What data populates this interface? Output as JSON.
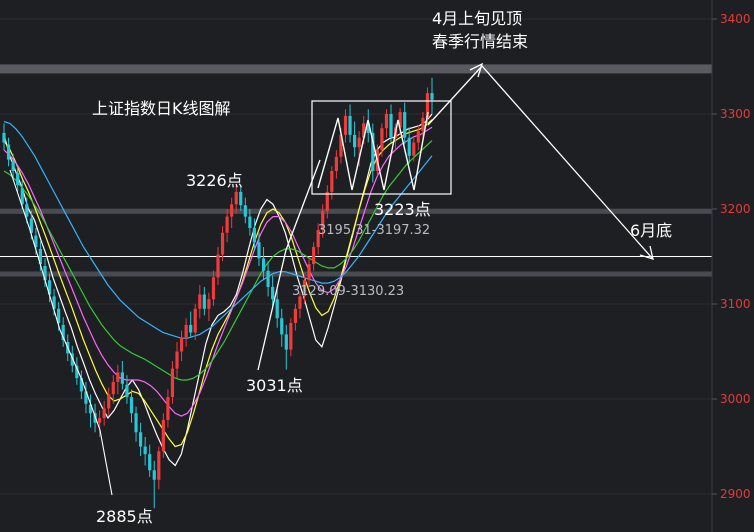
{
  "chart_data": {
    "type": "candlestick",
    "title": "上证指数日K线图解",
    "y_axis": {
      "ylim": [
        2860,
        3420
      ],
      "tick_values": [
        2900,
        3000,
        3100,
        3200,
        3300,
        3400
      ],
      "tick_labels": [
        "2900",
        "3000",
        "3100",
        "3200",
        "3300",
        "3400"
      ]
    },
    "candles_ohlc": [
      [
        3280,
        3290,
        3262,
        3270
      ],
      [
        3268,
        3275,
        3245,
        3252
      ],
      [
        3250,
        3258,
        3232,
        3240
      ],
      [
        3238,
        3245,
        3218,
        3225
      ],
      [
        3222,
        3230,
        3200,
        3205
      ],
      [
        3205,
        3212,
        3185,
        3192
      ],
      [
        3190,
        3198,
        3168,
        3175
      ],
      [
        3172,
        3180,
        3152,
        3160
      ],
      [
        3158,
        3166,
        3135,
        3142
      ],
      [
        3140,
        3148,
        3118,
        3125
      ],
      [
        3125,
        3132,
        3102,
        3110
      ],
      [
        3108,
        3116,
        3088,
        3095
      ],
      [
        3095,
        3102,
        3072,
        3080
      ],
      [
        3078,
        3086,
        3055,
        3062
      ],
      [
        3060,
        3068,
        3040,
        3048
      ],
      [
        3048,
        3056,
        3028,
        3035
      ],
      [
        3035,
        3044,
        3015,
        3022
      ],
      [
        3022,
        3030,
        3000,
        3008
      ],
      [
        3008,
        3018,
        2985,
        2995
      ],
      [
        2994,
        3005,
        2970,
        2985
      ],
      [
        2985,
        2995,
        2965,
        2975
      ],
      [
        2975,
        2988,
        2960,
        2980
      ],
      [
        2980,
        2998,
        2972,
        2990
      ],
      [
        2990,
        3012,
        2982,
        3005
      ],
      [
        3005,
        3025,
        2995,
        3018
      ],
      [
        3018,
        3036,
        3005,
        3028
      ],
      [
        3028,
        3040,
        3010,
        3016
      ],
      [
        3015,
        3025,
        2995,
        3002
      ],
      [
        3002,
        3010,
        2975,
        2985
      ],
      [
        2985,
        2992,
        2955,
        2965
      ],
      [
        2965,
        2975,
        2940,
        2950
      ],
      [
        2950,
        2960,
        2930,
        2942
      ],
      [
        2942,
        2952,
        2918,
        2925
      ],
      [
        2925,
        2935,
        2885,
        2915
      ],
      [
        2915,
        2950,
        2905,
        2945
      ],
      [
        2945,
        2985,
        2938,
        2978
      ],
      [
        2978,
        3010,
        2970,
        3002
      ],
      [
        3002,
        3040,
        2995,
        3032
      ],
      [
        3032,
        3060,
        3022,
        3050
      ],
      [
        3050,
        3072,
        3040,
        3065
      ],
      [
        3065,
        3085,
        3055,
        3078
      ],
      [
        3078,
        3092,
        3065,
        3070
      ],
      [
        3070,
        3100,
        3062,
        3095
      ],
      [
        3095,
        3120,
        3085,
        3110
      ],
      [
        3110,
        3118,
        3088,
        3095
      ],
      [
        3095,
        3112,
        3082,
        3105
      ],
      [
        3105,
        3135,
        3098,
        3128
      ],
      [
        3128,
        3160,
        3120,
        3152
      ],
      [
        3152,
        3182,
        3145,
        3175
      ],
      [
        3175,
        3200,
        3165,
        3192
      ],
      [
        3192,
        3212,
        3180,
        3205
      ],
      [
        3205,
        3226,
        3195,
        3218
      ],
      [
        3218,
        3225,
        3198,
        3204
      ],
      [
        3204,
        3212,
        3185,
        3192
      ],
      [
        3192,
        3200,
        3172,
        3180
      ],
      [
        3180,
        3190,
        3158,
        3165
      ],
      [
        3165,
        3175,
        3140,
        3148
      ],
      [
        3148,
        3160,
        3125,
        3135
      ],
      [
        3135,
        3145,
        3108,
        3118
      ],
      [
        3118,
        3130,
        3095,
        3105
      ],
      [
        3105,
        3115,
        3075,
        3085
      ],
      [
        3085,
        3095,
        3055,
        3068
      ],
      [
        3068,
        3078,
        3031,
        3052
      ],
      [
        3052,
        3085,
        3045,
        3080
      ],
      [
        3080,
        3100,
        3072,
        3095
      ],
      [
        3095,
        3112,
        3085,
        3108
      ],
      [
        3108,
        3130,
        3100,
        3125
      ],
      [
        3125,
        3148,
        3118,
        3142
      ],
      [
        3142,
        3165,
        3135,
        3160
      ],
      [
        3160,
        3185,
        3152,
        3178
      ],
      [
        3178,
        3205,
        3170,
        3198
      ],
      [
        3198,
        3225,
        3190,
        3218
      ],
      [
        3218,
        3245,
        3210,
        3240
      ],
      [
        3240,
        3262,
        3232,
        3255
      ],
      [
        3255,
        3285,
        3248,
        3278
      ],
      [
        3278,
        3305,
        3270,
        3298
      ],
      [
        3298,
        3310,
        3270,
        3278
      ],
      [
        3278,
        3292,
        3255,
        3265
      ],
      [
        3265,
        3282,
        3245,
        3275
      ],
      [
        3275,
        3298,
        3268,
        3290
      ],
      [
        3290,
        3305,
        3270,
        3280
      ],
      [
        3280,
        3290,
        3228,
        3240
      ],
      [
        3240,
        3268,
        3235,
        3262
      ],
      [
        3262,
        3290,
        3255,
        3285
      ],
      [
        3285,
        3305,
        3275,
        3300
      ],
      [
        3300,
        3310,
        3270,
        3275
      ],
      [
        3275,
        3290,
        3262,
        3286
      ],
      [
        3286,
        3306,
        3278,
        3302
      ],
      [
        3302,
        3312,
        3268,
        3275
      ],
      [
        3275,
        3286,
        3248,
        3256
      ],
      [
        3256,
        3275,
        3250,
        3270
      ],
      [
        3270,
        3288,
        3262,
        3282
      ],
      [
        3282,
        3302,
        3275,
        3296
      ],
      [
        3296,
        3328,
        3288,
        3322
      ],
      [
        3322,
        3338,
        3300,
        3315
      ]
    ],
    "moving_averages": [
      {
        "color": "#ffffff",
        "values": [
          3278,
          3255,
          3238,
          3222,
          3200,
          3188,
          3168,
          3150,
          3128,
          3110,
          3092,
          3075,
          3055,
          3038,
          3020,
          3005,
          2992,
          2980,
          2988,
          3000,
          3012,
          3020,
          3010,
          2995,
          2978,
          2962,
          2948,
          2936,
          2930,
          2942,
          2968,
          2998,
          3028,
          3058,
          3078,
          3088,
          3092,
          3098,
          3110,
          3132,
          3158,
          3182,
          3200,
          3210,
          3205,
          3192,
          3175,
          3152,
          3128,
          3108,
          3085,
          3062,
          3055,
          3075,
          3098,
          3122,
          3148,
          3172,
          3198,
          3222,
          3248,
          3262,
          3270,
          3274,
          3276,
          3280,
          3284,
          3286,
          3288,
          3292,
          3300
        ]
      },
      {
        "color": "#ffff33",
        "values": [
          3272,
          3262,
          3248,
          3232,
          3218,
          3202,
          3185,
          3168,
          3150,
          3132,
          3115,
          3098,
          3080,
          3062,
          3046,
          3030,
          3016,
          3004,
          2998,
          3000,
          3004,
          3008,
          3006,
          2998,
          2988,
          2978,
          2968,
          2958,
          2950,
          2952,
          2965,
          2985,
          3008,
          3032,
          3052,
          3068,
          3080,
          3092,
          3106,
          3124,
          3145,
          3166,
          3184,
          3196,
          3200,
          3196,
          3186,
          3170,
          3150,
          3130,
          3112,
          3096,
          3088,
          3092,
          3106,
          3126,
          3150,
          3174,
          3198,
          3220,
          3240,
          3254,
          3262,
          3268,
          3272,
          3276,
          3280,
          3282,
          3284,
          3288,
          3294
        ]
      },
      {
        "color": "#ff66ff",
        "values": [
          3262,
          3256,
          3248,
          3238,
          3226,
          3212,
          3198,
          3182,
          3166,
          3150,
          3134,
          3118,
          3102,
          3086,
          3072,
          3058,
          3046,
          3036,
          3028,
          3022,
          3020,
          3020,
          3020,
          3018,
          3014,
          3008,
          3000,
          2992,
          2985,
          2982,
          2985,
          2994,
          3006,
          3022,
          3040,
          3058,
          3074,
          3090,
          3106,
          3122,
          3140,
          3158,
          3174,
          3186,
          3192,
          3192,
          3186,
          3176,
          3162,
          3148,
          3134,
          3122,
          3114,
          3112,
          3116,
          3126,
          3140,
          3158,
          3178,
          3198,
          3218,
          3234,
          3246,
          3256,
          3262,
          3268,
          3272,
          3276,
          3278,
          3282,
          3286
        ]
      },
      {
        "color": "#33cc33",
        "values": [
          3240,
          3236,
          3230,
          3222,
          3214,
          3204,
          3194,
          3182,
          3170,
          3158,
          3146,
          3134,
          3122,
          3110,
          3098,
          3088,
          3078,
          3070,
          3062,
          3056,
          3052,
          3048,
          3045,
          3042,
          3038,
          3034,
          3030,
          3026,
          3022,
          3020,
          3020,
          3022,
          3026,
          3032,
          3040,
          3050,
          3060,
          3072,
          3084,
          3096,
          3108,
          3120,
          3132,
          3142,
          3150,
          3155,
          3158,
          3158,
          3156,
          3152,
          3148,
          3144,
          3140,
          3138,
          3138,
          3142,
          3148,
          3156,
          3166,
          3178,
          3190,
          3202,
          3214,
          3224,
          3232,
          3240,
          3248,
          3254,
          3260,
          3266,
          3272
        ]
      },
      {
        "color": "#33b5ff",
        "values": [
          3292,
          3290,
          3284,
          3276,
          3266,
          3256,
          3244,
          3232,
          3220,
          3208,
          3196,
          3184,
          3172,
          3160,
          3150,
          3140,
          3130,
          3120,
          3112,
          3104,
          3098,
          3092,
          3086,
          3082,
          3078,
          3074,
          3070,
          3068,
          3066,
          3064,
          3064,
          3066,
          3068,
          3072,
          3076,
          3082,
          3088,
          3094,
          3100,
          3106,
          3112,
          3118,
          3124,
          3128,
          3132,
          3134,
          3134,
          3132,
          3130,
          3128,
          3126,
          3124,
          3122,
          3122,
          3124,
          3128,
          3134,
          3142,
          3150,
          3160,
          3170,
          3180,
          3190,
          3200,
          3208,
          3216,
          3224,
          3232,
          3240,
          3248,
          3256
        ]
      }
    ],
    "reference_lines": [
      {
        "value": 3348,
        "style": "band"
      },
      {
        "value": 3196,
        "style": "band"
      },
      {
        "value": 3130,
        "style": "band"
      },
      {
        "value": 3150,
        "style": "line"
      }
    ],
    "annotations": [
      {
        "text": "3226点",
        "x_index": 51,
        "value": 3226
      },
      {
        "text": "3031点",
        "x_index": 62,
        "value": 3031
      },
      {
        "text": "2885点",
        "x_index": 33,
        "value": 2885
      },
      {
        "text": "3223点",
        "x_index": 86,
        "value": 3223
      },
      {
        "text": "3195.31-3197.32",
        "value": 3196
      },
      {
        "text": "3129.09-3130.23",
        "value": 3130
      },
      {
        "text": "4月上旬见顶",
        "value": 3410
      },
      {
        "text": "春季行情结束",
        "value": 3410
      },
      {
        "text": "6月底",
        "value": 3150
      }
    ]
  }
}
